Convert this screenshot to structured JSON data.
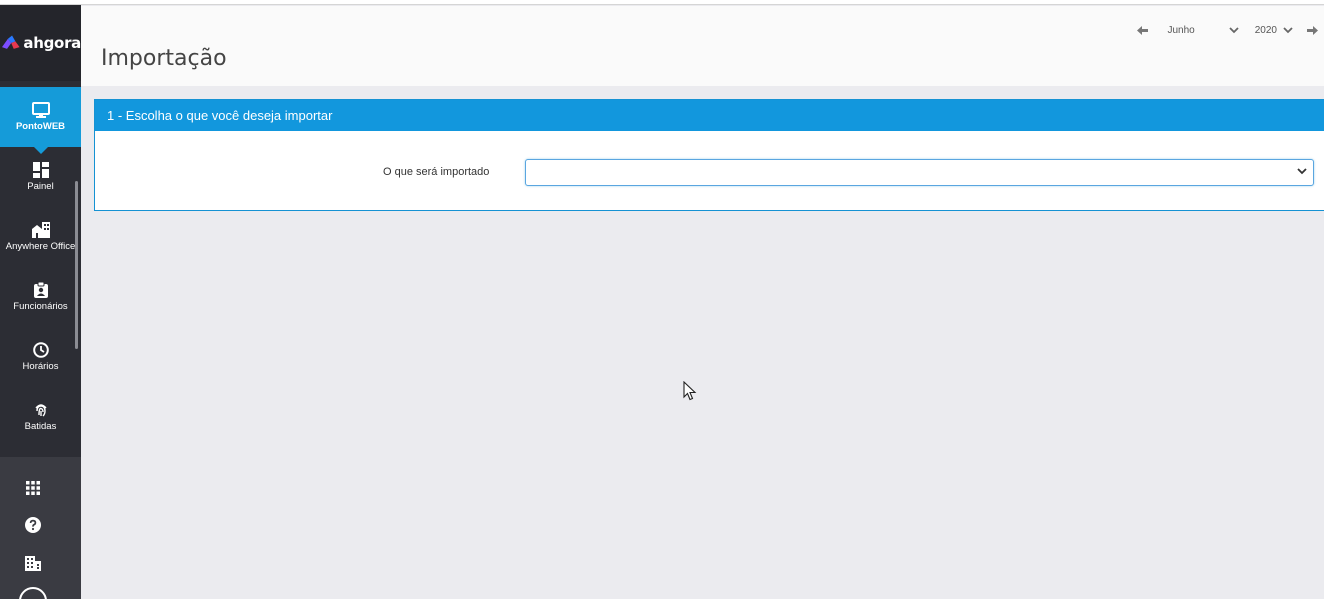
{
  "brand": {
    "name": "ahgora"
  },
  "sidebar": {
    "items": [
      {
        "label": "PontoWEB",
        "icon": "monitor-icon",
        "active": true
      },
      {
        "label": "Painel",
        "icon": "dashboard-icon"
      },
      {
        "label": "Anywhere Office",
        "icon": "buildings-icon"
      },
      {
        "label": "Funcionários",
        "icon": "badge-icon"
      },
      {
        "label": "Horários",
        "icon": "clock-icon"
      },
      {
        "label": "Batidas",
        "icon": "fingerprint-icon"
      }
    ],
    "bottom_icons": [
      "apps-grid-icon",
      "help-icon",
      "company-icon"
    ]
  },
  "header": {
    "title": "Importação",
    "period": {
      "month": "Junho",
      "year": "2020"
    }
  },
  "panel": {
    "title": "1 - Escolha o que você deseja importar",
    "field_label": "O que será importado",
    "field_value": ""
  },
  "colors": {
    "accent": "#1297dd",
    "sidebar": "#2c2d34",
    "background": "#ebebef"
  }
}
